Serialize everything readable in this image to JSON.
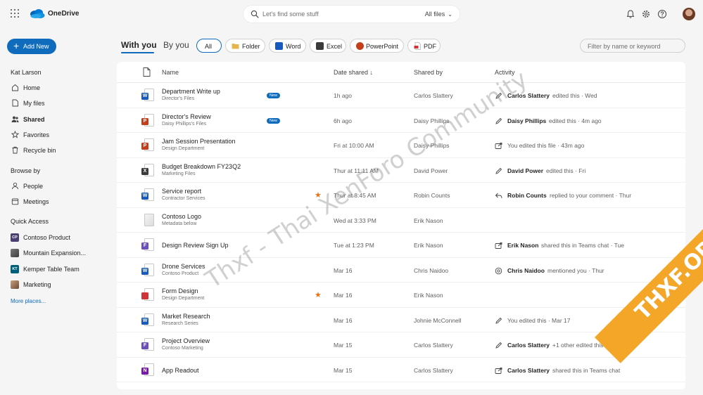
{
  "app": {
    "name": "OneDrive"
  },
  "search": {
    "placeholder": "Let's find some stuff",
    "scope": "All files"
  },
  "topbar": {
    "icons": [
      "bell-icon",
      "settings-icon",
      "help-icon",
      "avatar"
    ]
  },
  "nav": {
    "add_new": "Add New",
    "user": "Kat Larson",
    "items": [
      "Home",
      "My files",
      "Shared",
      "Favorites",
      "Recycle bin"
    ],
    "browse_by": "Browse by",
    "browse_items": [
      "People",
      "Meetings"
    ],
    "quick_access": "Quick Access",
    "quick_items": [
      {
        "label": "Contoso Product",
        "badge": "CP",
        "color": "#4b3f72"
      },
      {
        "label": "Mountain Expansion...",
        "badge": "",
        "color": "#5b5b5b"
      },
      {
        "label": "Kemper Table Team",
        "badge": "KT",
        "color": "#00607a"
      },
      {
        "label": "Marketing",
        "badge": "",
        "color": "#8a5a44"
      }
    ],
    "more": "More places..."
  },
  "tabs": {
    "with_you": "With you",
    "by_you": "By you"
  },
  "filters": [
    "All",
    "Folder",
    "Word",
    "Excel",
    "PowerPoint",
    "PDF"
  ],
  "filter_box": {
    "placeholder": "Filter by name or keyword"
  },
  "columns": {
    "name": "Name",
    "date": "Date shared",
    "by": "Shared by",
    "activity": "Activity"
  },
  "new_badge": "New",
  "files": [
    {
      "name": "Department Write up",
      "location": "Director's Files",
      "type": "word",
      "new": true,
      "fav": false,
      "date": "1h ago",
      "by": "Carlos Slattery",
      "act_icon": "pencil-icon",
      "act_who": "Carlos Slattery",
      "act_what": "edited this · Wed"
    },
    {
      "name": "Director's Review",
      "location": "Daisy Phillips's Files",
      "type": "ppt",
      "new": true,
      "fav": false,
      "date": "6h ago",
      "by": "Daisy Phillips",
      "act_icon": "pencil-icon",
      "act_who": "Daisy Phillips",
      "act_what": "edited this · 4m ago"
    },
    {
      "name": "Jam Session Presentation",
      "location": "Design Department",
      "type": "ppt",
      "new": false,
      "fav": false,
      "date": "Fri at 10:00 AM",
      "by": "Daisy Phillips",
      "act_icon": "share-icon",
      "act_who": "",
      "act_what": "You edited this file · 43m ago"
    },
    {
      "name": "Budget Breakdown FY23Q2",
      "location": "Marketing Files",
      "type": "excel",
      "new": false,
      "fav": false,
      "date": "Thur at 11:11 AM",
      "by": "David Power",
      "act_icon": "pencil-icon",
      "act_who": "David Power",
      "act_what": "edited this · Fri"
    },
    {
      "name": "Service report",
      "location": "Contractor Services",
      "type": "word",
      "new": false,
      "fav": true,
      "date": "Thur at 8:45 AM",
      "by": "Robin Counts",
      "act_icon": "reply-icon",
      "act_who": "Robin Counts",
      "act_what": "replied to your comment · Thur"
    },
    {
      "name": "Contoso Logo",
      "location": "Metadata below",
      "type": "image",
      "new": false,
      "fav": false,
      "date": "Wed at 3:33 PM",
      "by": "Erik Nason",
      "act_icon": "",
      "act_who": "",
      "act_what": ""
    },
    {
      "name": "Design Review Sign Up",
      "location": "",
      "type": "forms",
      "new": false,
      "fav": false,
      "date": "Tue at 1:23 PM",
      "by": "Erik Nason",
      "act_icon": "share-icon",
      "act_who": "Erik Nason",
      "act_what": "shared this in Teams chat · Tue"
    },
    {
      "name": "Drone Services",
      "location": "Contoso Product",
      "type": "word",
      "new": false,
      "fav": false,
      "date": "Mar 16",
      "by": "Chris Naidoo",
      "act_icon": "mention-icon",
      "act_who": "Chris Naidoo",
      "act_what": "mentioned you · Thur"
    },
    {
      "name": "Form Design",
      "location": "Design Department",
      "type": "pdf",
      "new": false,
      "fav": true,
      "date": "Mar 16",
      "by": "Erik Nason",
      "act_icon": "",
      "act_who": "",
      "act_what": ""
    },
    {
      "name": "Market Research",
      "location": "Research Series",
      "type": "word",
      "new": false,
      "fav": false,
      "date": "Mar 16",
      "by": "Johnie McConnell",
      "act_icon": "pencil-icon",
      "act_who": "",
      "act_what": "You edited this · Mar 17"
    },
    {
      "name": "Project Overview",
      "location": "Contoso Marketing",
      "type": "forms",
      "new": false,
      "fav": false,
      "date": "Mar 15",
      "by": "Carlos Slattery",
      "act_icon": "pencil-icon",
      "act_who": "Carlos Slattery",
      "act_what": "+1 other edited this · 3h ago"
    },
    {
      "name": "App Readout",
      "location": "",
      "type": "onenote",
      "new": false,
      "fav": false,
      "date": "Mar 15",
      "by": "Carlos Slattery",
      "act_icon": "share-icon",
      "act_who": "Carlos Slattery",
      "act_what": "shared this in Teams chat"
    }
  ],
  "watermark": {
    "text": "Thxf - Thai XenForo Community",
    "ribbon": "THXF.ORG"
  },
  "colors": {
    "accent": "#0f6cbd",
    "word": "#185abd",
    "ppt": "#c43e1c",
    "excel": "#107c41",
    "pdf": "#d13438",
    "forms": "#6b4fbb",
    "onenote": "#7719aa",
    "star": "#e8731a"
  }
}
